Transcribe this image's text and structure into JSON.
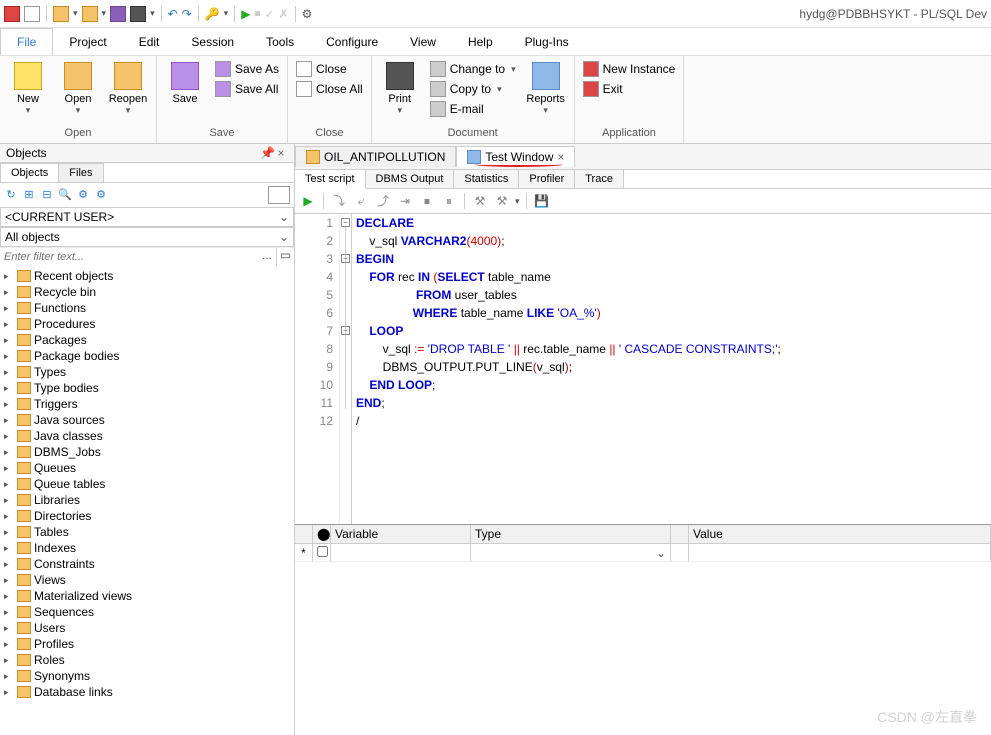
{
  "window": {
    "title": "hydg@PDBBHSYKT - PL/SQL Dev"
  },
  "menubar": [
    "File",
    "Project",
    "Edit",
    "Session",
    "Tools",
    "Configure",
    "View",
    "Help",
    "Plug-Ins"
  ],
  "menubar_active": 0,
  "ribbon": {
    "open": {
      "new": "New",
      "open": "Open",
      "reopen": "Reopen",
      "label": "Open"
    },
    "save": {
      "save": "Save",
      "saveas": "Save As",
      "saveall": "Save All",
      "label": "Save"
    },
    "close": {
      "close": "Close",
      "closeall": "Close All",
      "label": "Close"
    },
    "document": {
      "print": "Print",
      "changeto": "Change to",
      "copyto": "Copy to",
      "email": "E-mail",
      "reports": "Reports",
      "label": "Document"
    },
    "application": {
      "newinstance": "New Instance",
      "exit": "Exit",
      "label": "Application"
    }
  },
  "sidebar": {
    "title": "Objects",
    "tabs": [
      "Objects",
      "Files"
    ],
    "tabs_active": 0,
    "user_combo": "<CURRENT USER>",
    "scope_combo": "All objects",
    "filter_placeholder": "Enter filter text...",
    "tree": [
      "Recent objects",
      "Recycle bin",
      "Functions",
      "Procedures",
      "Packages",
      "Package bodies",
      "Types",
      "Type bodies",
      "Triggers",
      "Java sources",
      "Java classes",
      "DBMS_Jobs",
      "Queues",
      "Queue tables",
      "Libraries",
      "Directories",
      "Tables",
      "Indexes",
      "Constraints",
      "Views",
      "Materialized views",
      "Sequences",
      "Users",
      "Profiles",
      "Roles",
      "Synonyms",
      "Database links"
    ]
  },
  "editor": {
    "tabs": [
      {
        "label": "OIL_ANTIPOLLUTION",
        "icon": "y",
        "active": false
      },
      {
        "label": "Test Window",
        "icon": "b",
        "active": true,
        "closable": true
      }
    ],
    "subtabs": [
      "Test script",
      "DBMS Output",
      "Statistics",
      "Profiler",
      "Trace"
    ],
    "subtabs_active": 0,
    "code": [
      {
        "n": 1,
        "tokens": [
          [
            "kw",
            "DECLARE"
          ]
        ]
      },
      {
        "n": 2,
        "tokens": [
          [
            "id",
            "    v_sql "
          ],
          [
            "kw",
            "VARCHAR2"
          ],
          [
            "punct",
            "("
          ],
          [
            "num",
            "4000"
          ],
          [
            "punct",
            ")"
          ],
          [
            "id",
            ";"
          ]
        ]
      },
      {
        "n": 3,
        "tokens": [
          [
            "kw",
            "BEGIN"
          ]
        ]
      },
      {
        "n": 4,
        "tokens": [
          [
            "id",
            "    "
          ],
          [
            "kw",
            "FOR"
          ],
          [
            "id",
            " rec "
          ],
          [
            "kw",
            "IN"
          ],
          [
            "id",
            " "
          ],
          [
            "punct",
            "("
          ],
          [
            "kw",
            "SELECT"
          ],
          [
            "id",
            " table_name"
          ]
        ]
      },
      {
        "n": 5,
        "tokens": [
          [
            "id",
            "                  "
          ],
          [
            "kw",
            "FROM"
          ],
          [
            "id",
            " user_tables"
          ]
        ]
      },
      {
        "n": 6,
        "tokens": [
          [
            "id",
            "                 "
          ],
          [
            "kw",
            "WHERE"
          ],
          [
            "id",
            " table_name "
          ],
          [
            "kw",
            "LIKE"
          ],
          [
            "id",
            " "
          ],
          [
            "str",
            "'OA_%'"
          ],
          [
            "punct",
            ")"
          ]
        ]
      },
      {
        "n": 7,
        "tokens": [
          [
            "id",
            "    "
          ],
          [
            "kw",
            "LOOP"
          ]
        ]
      },
      {
        "n": 8,
        "tokens": [
          [
            "id",
            "        v_sql "
          ],
          [
            "punct",
            ":="
          ],
          [
            "id",
            " "
          ],
          [
            "str",
            "'DROP TABLE '"
          ],
          [
            "id",
            " "
          ],
          [
            "punct",
            "||"
          ],
          [
            "id",
            " rec.table_name "
          ],
          [
            "punct",
            "||"
          ],
          [
            "id",
            " "
          ],
          [
            "str",
            "' CASCADE CONSTRAINTS;'"
          ],
          [
            "id",
            ";"
          ]
        ]
      },
      {
        "n": 9,
        "tokens": [
          [
            "id",
            "        DBMS_OUTPUT.PUT_LINE"
          ],
          [
            "punct",
            "("
          ],
          [
            "id",
            "v_sql"
          ],
          [
            "punct",
            ")"
          ],
          [
            "id",
            ";"
          ]
        ]
      },
      {
        "n": 10,
        "tokens": [
          [
            "id",
            "    "
          ],
          [
            "kw",
            "END"
          ],
          [
            "id",
            " "
          ],
          [
            "kw",
            "LOOP"
          ],
          [
            "id",
            ";"
          ]
        ]
      },
      {
        "n": 11,
        "tokens": [
          [
            "kw",
            "END"
          ],
          [
            "id",
            ";"
          ]
        ]
      },
      {
        "n": 12,
        "tokens": [
          [
            "id",
            "/"
          ]
        ]
      }
    ],
    "grid": {
      "headers": [
        "",
        "",
        "Variable",
        "Type",
        "",
        "Value"
      ]
    }
  },
  "watermark": "CSDN @左直拳"
}
